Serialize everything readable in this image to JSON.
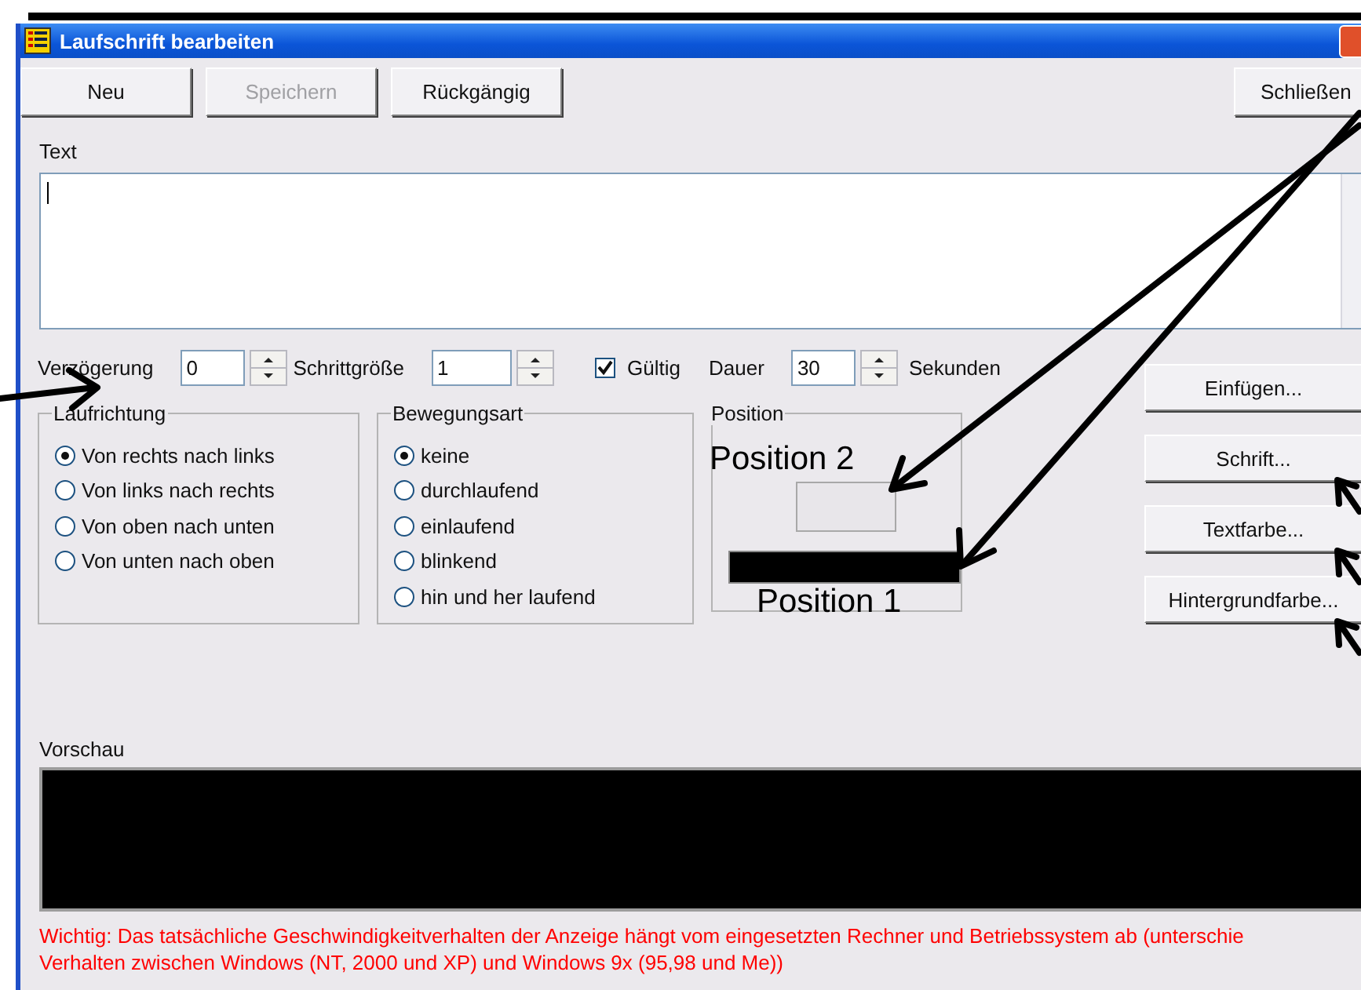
{
  "window": {
    "title": "Laufschrift bearbeiten"
  },
  "toolbar": [
    {
      "label": "Neu",
      "disabled": false
    },
    {
      "label": "Speichern",
      "disabled": true
    },
    {
      "label": "Rückgängig",
      "disabled": false
    },
    {
      "label": "Schließen",
      "disabled": false
    }
  ],
  "text_field": {
    "label": "Text"
  },
  "settings": [
    {
      "kind": "spinner",
      "label": "Verzögerung",
      "value": "0"
    },
    {
      "kind": "spinner",
      "label": "Schrittgröße",
      "value": "1"
    },
    {
      "kind": "checkbox",
      "label": "Gültig",
      "checked": true
    },
    {
      "kind": "spinner",
      "label": "Dauer",
      "value": "30",
      "suffix": "Sekunden"
    }
  ],
  "groups": [
    {
      "title": "Laufrichtung",
      "options": [
        {
          "label": "Von rechts nach links",
          "selected": true
        },
        {
          "label": "Von links nach rechts",
          "selected": false
        },
        {
          "label": "Von oben nach unten",
          "selected": false
        },
        {
          "label": "Von unten nach oben",
          "selected": false
        }
      ]
    },
    {
      "title": "Bewegungsart",
      "options": [
        {
          "label": "keine",
          "selected": true
        },
        {
          "label": "durchlaufend",
          "selected": false
        },
        {
          "label": "einlaufend",
          "selected": false
        },
        {
          "label": "blinkend",
          "selected": false
        },
        {
          "label": "hin und her laufend",
          "selected": false
        }
      ]
    }
  ],
  "position": {
    "title": "Position",
    "annotations": [
      "Position 2",
      "Position 1"
    ]
  },
  "side_buttons": [
    "Einfügen...",
    "Schrift...",
    "Textfarbe...",
    "Hintergrundfarbe..."
  ],
  "preview": {
    "label": "Vorschau"
  },
  "note_lines": [
    "Wichtig: Das tatsächliche Geschwindigkeitverhalten der Anzeige hängt vom eingesetzten Rechner und Betriebssystem ab (unterschie",
    "Verhalten zwischen Windows (NT, 2000 und XP) und Windows 9x (95,98 und Me))"
  ]
}
